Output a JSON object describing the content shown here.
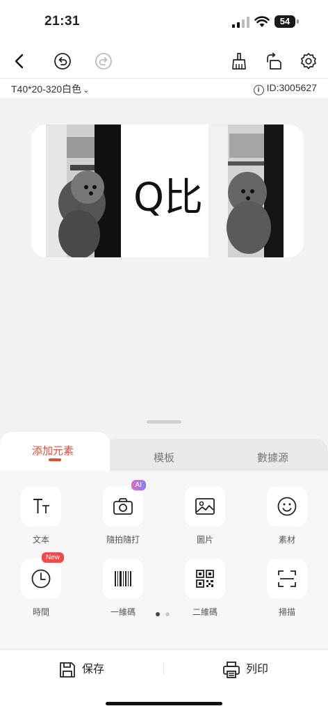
{
  "status": {
    "time": "21:31",
    "battery": "54"
  },
  "device": {
    "model": "T40*20-320白色",
    "id": "ID:3005627"
  },
  "label": {
    "text": "Q比"
  },
  "tabs": [
    "添加元素",
    "模板",
    "數據源"
  ],
  "tools": [
    {
      "label": "文本",
      "icon": "text-icon"
    },
    {
      "label": "隨拍隨打",
      "icon": "camera-icon",
      "badge": "AI"
    },
    {
      "label": "圖片",
      "icon": "image-icon"
    },
    {
      "label": "素材",
      "icon": "smiley-icon"
    },
    {
      "label": "時間",
      "icon": "clock-icon",
      "badge": "New"
    },
    {
      "label": "一維碼",
      "icon": "barcode-icon"
    },
    {
      "label": "二維碼",
      "icon": "qrcode-icon"
    },
    {
      "label": "掃描",
      "icon": "scan-icon"
    }
  ],
  "bottom": {
    "save": "保存",
    "print": "列印"
  },
  "colors": {
    "accent": "#e04a3b",
    "background": "#f2f2f2"
  }
}
